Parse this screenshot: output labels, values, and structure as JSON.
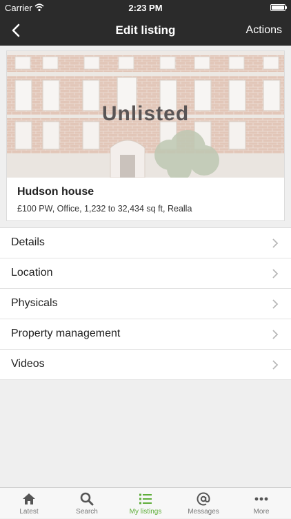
{
  "status_bar": {
    "carrier": "Carrier",
    "time": "2:23 PM",
    "battery_level": 1.0
  },
  "nav": {
    "title": "Edit listing",
    "actions_label": "Actions"
  },
  "listing": {
    "status_overlay": "Unlisted",
    "name": "Hudson house",
    "summary": "£100 PW, Office, 1,232 to 32,434 sq ft, Realla"
  },
  "menu": {
    "items": [
      {
        "label": "Details"
      },
      {
        "label": "Location"
      },
      {
        "label": "Physicals"
      },
      {
        "label": "Property management"
      },
      {
        "label": "Videos"
      }
    ]
  },
  "tabbar": {
    "active_color": "#5fae3a",
    "inactive_color": "#555555",
    "items": [
      {
        "label": "Latest",
        "icon": "home-icon"
      },
      {
        "label": "Search",
        "icon": "search-icon"
      },
      {
        "label": "My listings",
        "icon": "list-icon",
        "active": true
      },
      {
        "label": "Messages",
        "icon": "at-icon"
      },
      {
        "label": "More",
        "icon": "more-icon"
      }
    ]
  }
}
